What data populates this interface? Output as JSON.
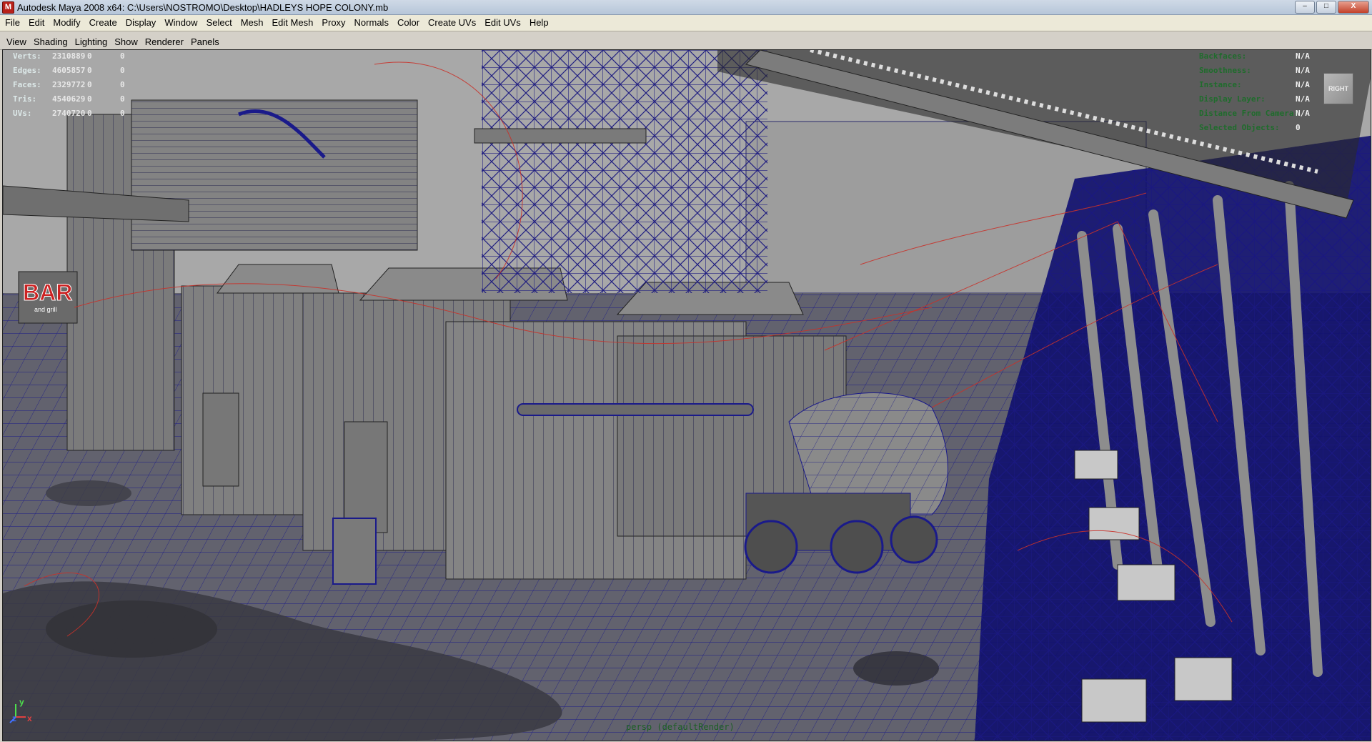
{
  "window": {
    "title": "Autodesk Maya 2008 x64: C:\\Users\\NOSTROMO\\Desktop\\HADLEYS HOPE COLONY.mb",
    "app_icon": "M",
    "controls": [
      "–",
      "□",
      "X"
    ]
  },
  "main_menu": [
    "File",
    "Edit",
    "Modify",
    "Create",
    "Display",
    "Window",
    "Select",
    "Mesh",
    "Edit Mesh",
    "Proxy",
    "Normals",
    "Color",
    "Create UVs",
    "Edit UVs",
    "Help"
  ],
  "panel_menu": [
    "View",
    "Shading",
    "Lighting",
    "Show",
    "Renderer",
    "Panels"
  ],
  "hud_stats": [
    {
      "label": "Verts:",
      "v1": "2310889",
      "v2": "0",
      "v3": "0"
    },
    {
      "label": "Edges:",
      "v1": "4605857",
      "v2": "0",
      "v3": "0"
    },
    {
      "label": "Faces:",
      "v1": "2329772",
      "v2": "0",
      "v3": "0"
    },
    {
      "label": "Tris:",
      "v1": "4540629",
      "v2": "0",
      "v3": "0"
    },
    {
      "label": "UVs:",
      "v1": "2740720",
      "v2": "0",
      "v3": "0"
    }
  ],
  "hud_right": [
    {
      "label": "Backfaces:",
      "value": "N/A"
    },
    {
      "label": "Smoothness:",
      "value": "N/A"
    },
    {
      "label": "Instance:",
      "value": "N/A"
    },
    {
      "label": "Display Layer:",
      "value": "N/A"
    },
    {
      "label": "Distance From Camera:",
      "value": "N/A"
    },
    {
      "label": "Selected Objects:",
      "value": "0"
    }
  ],
  "viewcube_label": "RIGHT",
  "camera_label": "persp (defaultRender)",
  "axis": {
    "y": "y",
    "x": "x",
    "z": "z"
  },
  "scene_sign": {
    "title": "BAR",
    "subtitle": "and grill"
  },
  "colors": {
    "wire": "#16157a",
    "curve": "#c8322a",
    "mesh_grey": "#7d7d7d",
    "sky": "#a6a6a6",
    "ground": "#5c5c68"
  }
}
